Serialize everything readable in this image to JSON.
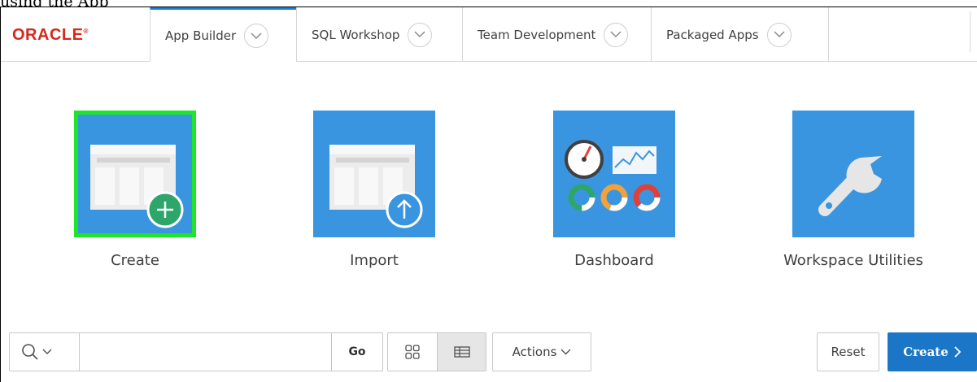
{
  "caption_fragment": "using the App",
  "brand": {
    "logo_text": "ORACLE",
    "registered_mark": "®",
    "color": "#d5291d"
  },
  "nav": {
    "tabs": [
      {
        "label": "App Builder",
        "active": true
      },
      {
        "label": "SQL Workshop",
        "active": false
      },
      {
        "label": "Team Development",
        "active": false
      },
      {
        "label": "Packaged Apps",
        "active": false
      }
    ]
  },
  "tiles": [
    {
      "label": "Create",
      "icon": "create-app-icon",
      "highlighted": true
    },
    {
      "label": "Import",
      "icon": "import-app-icon",
      "highlighted": false
    },
    {
      "label": "Dashboard",
      "icon": "dashboard-icon",
      "highlighted": false
    },
    {
      "label": "Workspace Utilities",
      "icon": "wrench-icon",
      "highlighted": false
    }
  ],
  "toolbar": {
    "search": {
      "value": "",
      "placeholder": ""
    },
    "go_label": "Go",
    "view_options": [
      "icons-view",
      "report-view"
    ],
    "selected_view": "report-view",
    "actions_label": "Actions",
    "reset_label": "Reset",
    "create_label": "Create"
  },
  "colors": {
    "tile_blue": "#3a95e0",
    "highlight_green": "#1ee52a",
    "accent_blue": "#1b80d7",
    "create_button_blue": "#1b76c7",
    "plus_badge_green": "#2da56b"
  }
}
